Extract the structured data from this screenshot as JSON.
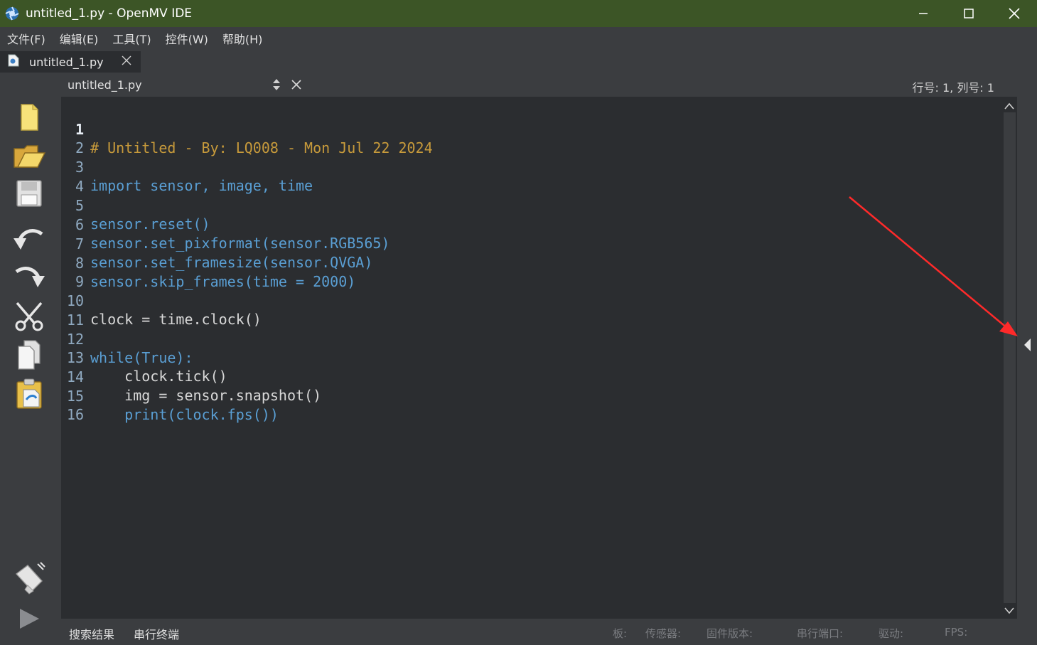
{
  "window": {
    "title": "untitled_1.py - OpenMV IDE",
    "app_icon": "openmv-aperture-icon",
    "controls": [
      "minimize-icon",
      "maximize-icon",
      "close-icon"
    ]
  },
  "menu": {
    "items": [
      "文件(F)",
      "编辑(E)",
      "工具(T)",
      "控件(W)",
      "帮助(H)"
    ]
  },
  "tabs": {
    "items": [
      {
        "label": "untitled_1.py",
        "icon": "python-file-icon"
      }
    ]
  },
  "toolbar": {
    "icons": [
      "new-file-icon",
      "open-folder-icon",
      "save-icon",
      "undo-icon",
      "redo-icon",
      "cut-icon",
      "copy-icon",
      "paste-icon"
    ],
    "bottom_icons": [
      "connect-usb-icon",
      "run-icon"
    ]
  },
  "editor": {
    "document": "untitled_1.py",
    "position": "行号: 1, 列号: 1",
    "lines": [
      "# Untitled - By: LQ008 - Mon Jul 22 2024",
      "",
      "import sensor, image, time",
      "",
      "sensor.reset()",
      "sensor.set_pixformat(sensor.RGB565)",
      "sensor.set_framesize(sensor.QVGA)",
      "sensor.skip_frames(time = 2000)",
      "",
      "clock = time.clock()",
      "",
      "while(True):",
      "    clock.tick()",
      "    img = sensor.snapshot()",
      "    print(clock.fps())",
      ""
    ],
    "line_numbers": [
      "1",
      "2",
      "3",
      "4",
      "5",
      "6",
      "7",
      "8",
      "9",
      "10",
      "11",
      "12",
      "13",
      "14",
      "15",
      "16"
    ]
  },
  "statusbar": {
    "buttons": [
      "搜索结果",
      "串行终端"
    ],
    "info": [
      "板:",
      "传感器:",
      "固件版本:",
      "串行端口:",
      "驱动:",
      "FPS:"
    ]
  },
  "colors": {
    "titlebar": "#3c5526",
    "comment": "#c79a3b",
    "keyword": "#5a9fd4",
    "function": "#d58ef0",
    "annotation_arrow": "#ff2a2a"
  }
}
